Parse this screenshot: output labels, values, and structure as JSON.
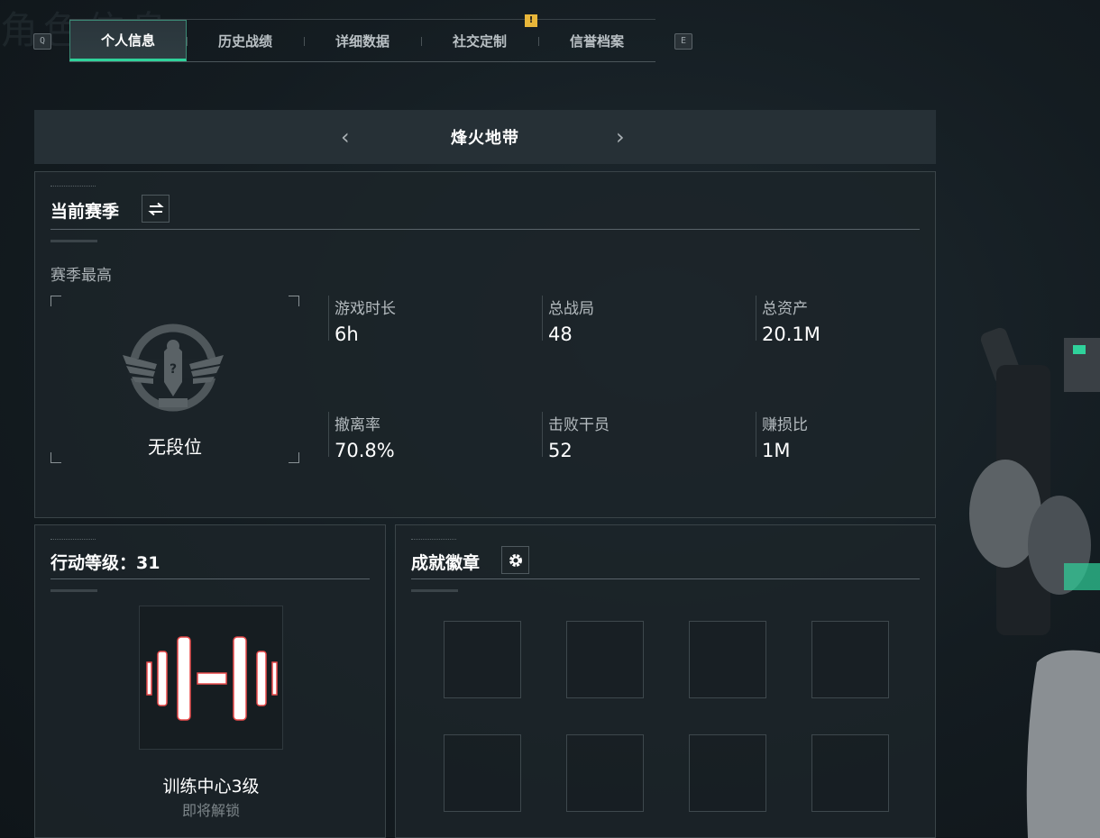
{
  "nav": {
    "prev_key": "Q",
    "next_key": "E",
    "tabs": [
      {
        "label": "个人信息",
        "active": true
      },
      {
        "label": "历史战绩",
        "active": false
      },
      {
        "label": "详细数据",
        "active": false
      },
      {
        "label": "社交定制",
        "active": false,
        "alert": "!"
      },
      {
        "label": "信誉档案",
        "active": false
      }
    ]
  },
  "mode": {
    "title": "烽火地带",
    "prev_arrow": "‹",
    "next_arrow": "›"
  },
  "season": {
    "heading": "当前赛季",
    "best_label": "赛季最高",
    "rank_text": "无段位",
    "stats": [
      {
        "label": "游戏时长",
        "value": "6h"
      },
      {
        "label": "总战局",
        "value": "48"
      },
      {
        "label": "总资产",
        "value": "20.1M"
      },
      {
        "label": "撤离率",
        "value": "70.8%"
      },
      {
        "label": "击败干员",
        "value": "52"
      },
      {
        "label": "赚损比",
        "value": "1M"
      }
    ]
  },
  "action_level": {
    "heading": "行动等级：31",
    "unlock_name": "训练中心3级",
    "unlock_status": "即将解锁"
  },
  "achievements": {
    "heading": "成就徽章",
    "slot_count": 8
  },
  "colors": {
    "accent": "#2fd29b",
    "alert": "#e8b63a",
    "panel_bg": "#1c2429"
  },
  "icons": [
    "swap-icon",
    "gear-icon",
    "rank-eagle-emblem",
    "dumbbell-icon",
    "chevron-left-icon",
    "chevron-right-icon"
  ]
}
